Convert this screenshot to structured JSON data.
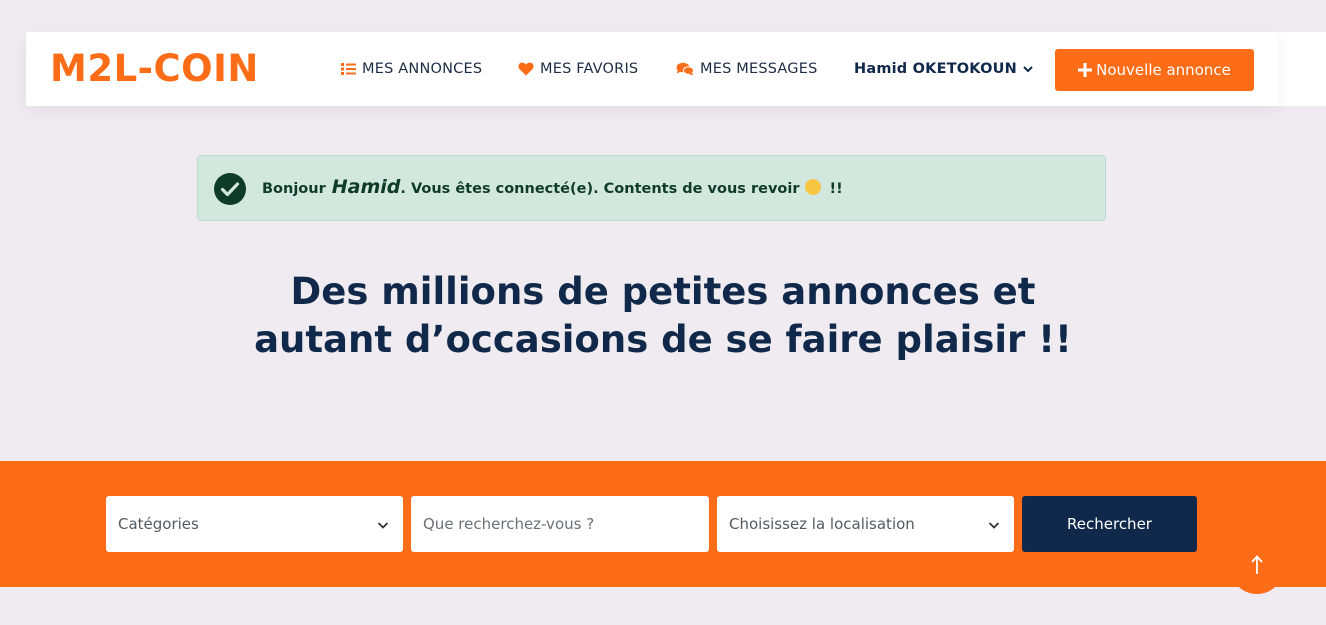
{
  "header": {
    "logo": "M2L-COIN",
    "nav": {
      "annonces": "MES ANNONCES",
      "favoris": "MES FAVORIS",
      "messages": "MES MESSAGES",
      "user": "Hamid OKETOKOUN"
    },
    "new_button": "Nouvelle annonce",
    "icons": {
      "annonces": "list-icon",
      "favoris": "heart-icon",
      "messages": "comments-icon",
      "user": "chevron-down-icon",
      "new": "plus-icon"
    }
  },
  "alert": {
    "greeting": "Bonjour",
    "name": "Hamid",
    "message": ". Vous êtes connecté(e). Contents de vous revoir",
    "suffix": "!!",
    "icon": "check-circle-icon"
  },
  "hero": {
    "line1": "Des millions de petites annonces et",
    "line2": "autant d’occasions de se faire plaisir !!"
  },
  "search": {
    "category_select": "Catégories",
    "query_placeholder": "Que recherchez-vous ?",
    "location_select": "Choisissez la localisation",
    "button": "Rechercher"
  },
  "colors": {
    "accent": "#fd6c16",
    "navy": "#10294a",
    "background": "#efebf0",
    "alert_bg": "#d2e7dd"
  }
}
